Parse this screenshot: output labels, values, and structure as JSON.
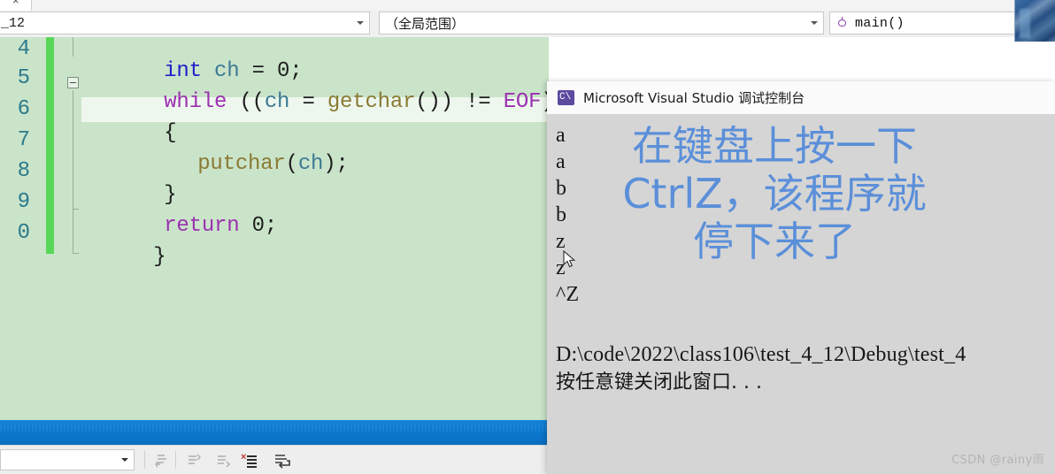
{
  "window": {
    "tab_close_label": "×",
    "file_combo_value": "_12",
    "scope_combo_value": "（全局范围）",
    "function_combo_value": "main()"
  },
  "editor": {
    "background_color": "#cae4ca",
    "line_number_color": "#2b7a8c",
    "change_bar_color": "#57d657",
    "lines": [
      {
        "number": "4",
        "code_html": "int ch = 0;"
      },
      {
        "number": "5",
        "code_html": "while ((ch = getchar()) != EOF)"
      },
      {
        "number": "6",
        "code_html": "{"
      },
      {
        "number": "7",
        "code_html": "    putchar(ch);"
      },
      {
        "number": "8",
        "code_html": "}"
      },
      {
        "number": "9",
        "code_html": "return 0;"
      },
      {
        "number": "0",
        "code_html": "}"
      }
    ],
    "tokens": {
      "l14": {
        "kw": "int",
        "ident": "ch",
        "op": "=",
        "num": "0;"
      },
      "l15": {
        "kw": "while",
        "rest1": "((",
        "ident": "ch",
        "op": "=",
        "fn": "getchar",
        "rest2": "())",
        "neq": "!=",
        "eof": "EOF",
        "rest3": ")"
      },
      "l16": {
        "brace": "{"
      },
      "l17": {
        "fn": "putchar",
        "open": "(",
        "ident": "ch",
        "close": ");"
      },
      "l18": {
        "brace": "}"
      },
      "l19": {
        "kw": "return",
        "num": "0;"
      },
      "l20": {
        "brace": "}"
      }
    }
  },
  "console": {
    "title": "Microsoft Visual Studio 调试控制台",
    "app_icon": "console-app-icon",
    "output_chars": [
      "a",
      "a",
      "b",
      "b",
      "z",
      "z",
      "^Z"
    ],
    "exit_path_line": "D:\\code\\2022\\class106\\test_4_12\\Debug\\test_4",
    "close_prompt_line": "按任意键关闭此窗口. . ."
  },
  "annotation": {
    "text": "在键盘上按一下\nCtrlZ，该程序就\n停下来了",
    "color": "#5b8fd9"
  },
  "bottom_toolbar": {
    "combo_value": "",
    "icons": [
      "go-to-previous-message-icon",
      "go-to-next-message-icon",
      "go-to-next-location-icon",
      "clear-all-icon",
      "toggle-word-wrap-icon"
    ]
  },
  "status_bar": {
    "color": "#0b79d0"
  },
  "watermark": {
    "text": "CSDN @rainy雨"
  }
}
